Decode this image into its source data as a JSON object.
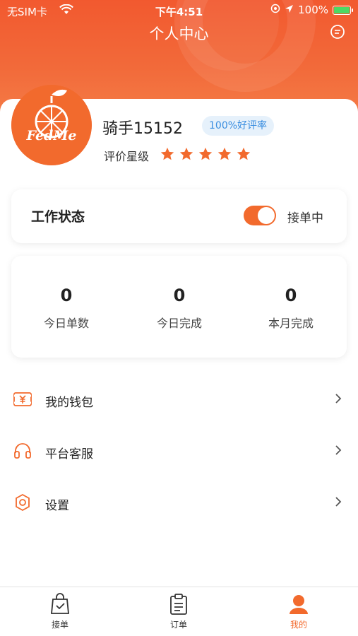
{
  "status_bar": {
    "carrier": "无SIM卡",
    "time": "下午4:51",
    "battery": "100%"
  },
  "header": {
    "title": "个人中心"
  },
  "profile": {
    "logo_text": "FedMe",
    "username": "骑手15152",
    "rating_badge": "100%好评率",
    "star_label": "评价星级",
    "star_rating": 5,
    "star_max": 5
  },
  "work_status": {
    "title": "工作状态",
    "toggle_on": true,
    "toggle_label": "接单中"
  },
  "stats": [
    {
      "value": "0",
      "label": "今日单数"
    },
    {
      "value": "0",
      "label": "今日完成"
    },
    {
      "value": "0",
      "label": "本月完成"
    }
  ],
  "menu": [
    {
      "label": "我的钱包",
      "icon": "wallet-icon"
    },
    {
      "label": "平台客服",
      "icon": "headset-icon"
    },
    {
      "label": "设置",
      "icon": "gear-icon"
    }
  ],
  "tabs": [
    {
      "label": "接单",
      "icon": "bag-icon",
      "active": false
    },
    {
      "label": "订单",
      "icon": "clipboard-icon",
      "active": false
    },
    {
      "label": "我的",
      "icon": "person-icon",
      "active": true
    }
  ],
  "colors": {
    "accent": "#f26a2d",
    "badge_text": "#3a8ee0",
    "badge_bg": "#e6f1fb"
  }
}
